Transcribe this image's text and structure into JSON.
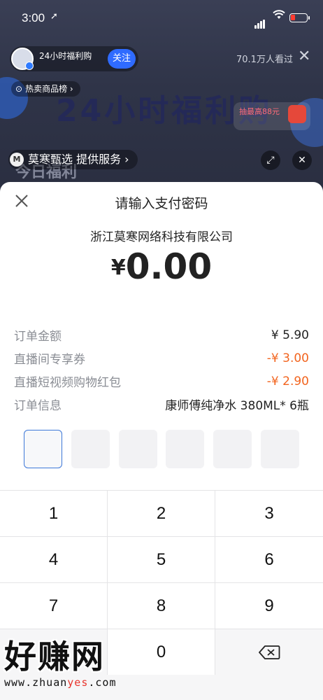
{
  "status_bar": {
    "time": "3:00",
    "location_icon": "location-arrow-icon",
    "wifi_icon": "wifi-icon",
    "battery_icon": "battery-low-icon"
  },
  "live_room": {
    "streamer_name": "24小时福利购",
    "streamer_sub": "",
    "follow_label": "关注",
    "viewers": "70.1万人看过",
    "close_icon": "close-icon",
    "hot_tag": "热卖商品榜",
    "banner_text": "24小时福利购",
    "promo_text": "抽最高88元",
    "service_logo": "M",
    "service_text": "莫寒甄选 提供服务",
    "today_text": "今日福利"
  },
  "payment": {
    "title": "请输入支付密码",
    "merchant": "浙江莫寒网络科技有限公司",
    "currency": "¥",
    "amount": "0.00",
    "details": [
      {
        "label": "订单金额",
        "value": "¥ 5.90",
        "highlight": false
      },
      {
        "label": "直播间专享券",
        "value": "-¥ 3.00",
        "highlight": true
      },
      {
        "label": "直播短视频购物红包",
        "value": "-¥ 2.90",
        "highlight": true
      },
      {
        "label": "订单信息",
        "value": "康师傅纯净水 380ML* 6瓶",
        "highlight": false
      }
    ],
    "pin_length": 6,
    "accent_color": "#f2641e",
    "focus_color": "#3d78d8"
  },
  "keypad": {
    "keys": [
      "1",
      "2",
      "3",
      "4",
      "5",
      "6",
      "7",
      "8",
      "9",
      "",
      "0",
      "⌫"
    ]
  },
  "watermark": {
    "title": "好赚网",
    "url_pre": "www.zhuan",
    "url_hl": "yes",
    "url_post": ".com"
  }
}
